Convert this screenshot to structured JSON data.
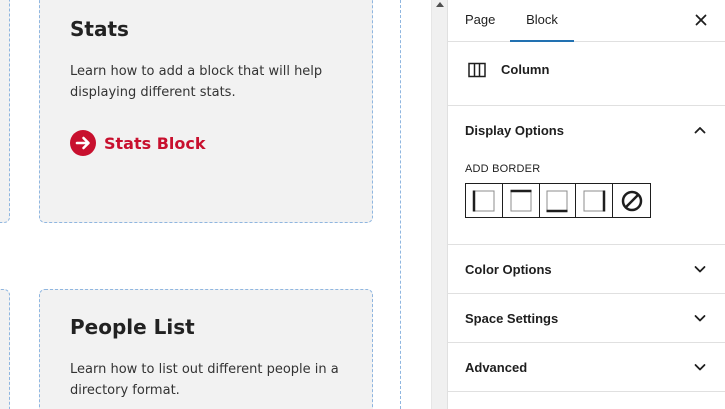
{
  "canvas": {
    "cards": [
      {
        "title": "Stats",
        "description": "Learn how to add a block that will help displaying different stats.",
        "link_label": "Stats Block"
      },
      {
        "title": "People List",
        "description": "Learn how to list out different people in a directory format."
      }
    ],
    "accent_color": "#c8102e"
  },
  "sidebar": {
    "tabs": [
      {
        "label": "Page",
        "active": false
      },
      {
        "label": "Block",
        "active": true
      }
    ],
    "close_icon": "close-icon",
    "block": {
      "name": "Column",
      "icon": "columns-icon"
    },
    "panels": [
      {
        "title": "Display Options",
        "expanded": true,
        "add_border_label": "ADD BORDER",
        "border_options": [
          "border-left-icon",
          "border-top-icon",
          "border-bottom-icon",
          "border-right-icon",
          "no-border-icon"
        ]
      },
      {
        "title": "Color Options",
        "expanded": false
      },
      {
        "title": "Space Settings",
        "expanded": false
      },
      {
        "title": "Advanced",
        "expanded": false
      }
    ],
    "tab_active_color": "#2271b1"
  }
}
